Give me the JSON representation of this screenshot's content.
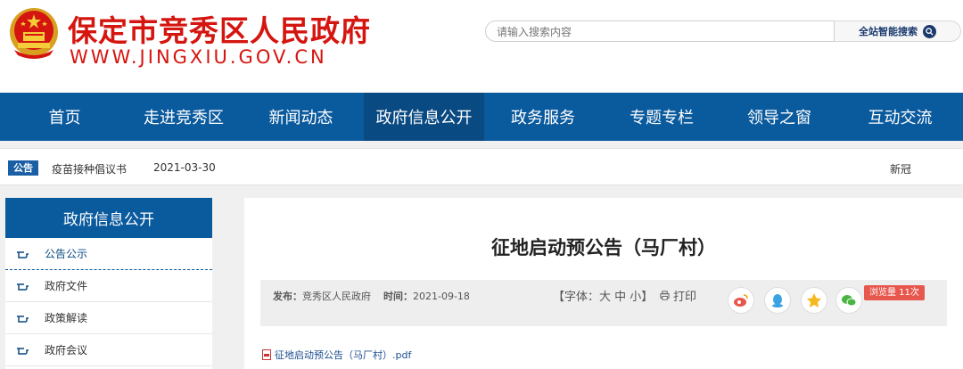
{
  "header": {
    "site_title": "保定市竞秀区人民政府",
    "site_url": "WWW.JINGXIU.GOV.CN",
    "search_placeholder": "请输入搜索内容",
    "search_button": "全站智能搜索"
  },
  "nav": {
    "items": [
      "首页",
      "走进竞秀区",
      "新闻动态",
      "政府信息公开",
      "政务服务",
      "专题专栏",
      "领导之窗",
      "互动交流"
    ],
    "active": "政府信息公开"
  },
  "notice": {
    "badge": "公告",
    "title": "疫苗接种倡议书",
    "date": "2021-03-30",
    "right_text": "新冠"
  },
  "sidebar": {
    "heading": "政府信息公开",
    "items": [
      "公告公示",
      "政府文件",
      "政策解读",
      "政府会议"
    ]
  },
  "article": {
    "title": "征地启动预公告（马厂村）",
    "publisher_label": "发布：",
    "publisher": "竞秀区人民政府",
    "time_label": "时间：",
    "time": "2021-09-18",
    "font_size_label": "【字体：大 中 小】",
    "print_label": "打印",
    "views_label": "浏览量 11次",
    "attachment": "征地启动预公告（马厂村）.pdf"
  },
  "colors": {
    "brand_red": "#d5150f",
    "nav_blue": "#0a5a9e",
    "nav_active": "#0a4a82",
    "views_badge": "#e8574d"
  }
}
